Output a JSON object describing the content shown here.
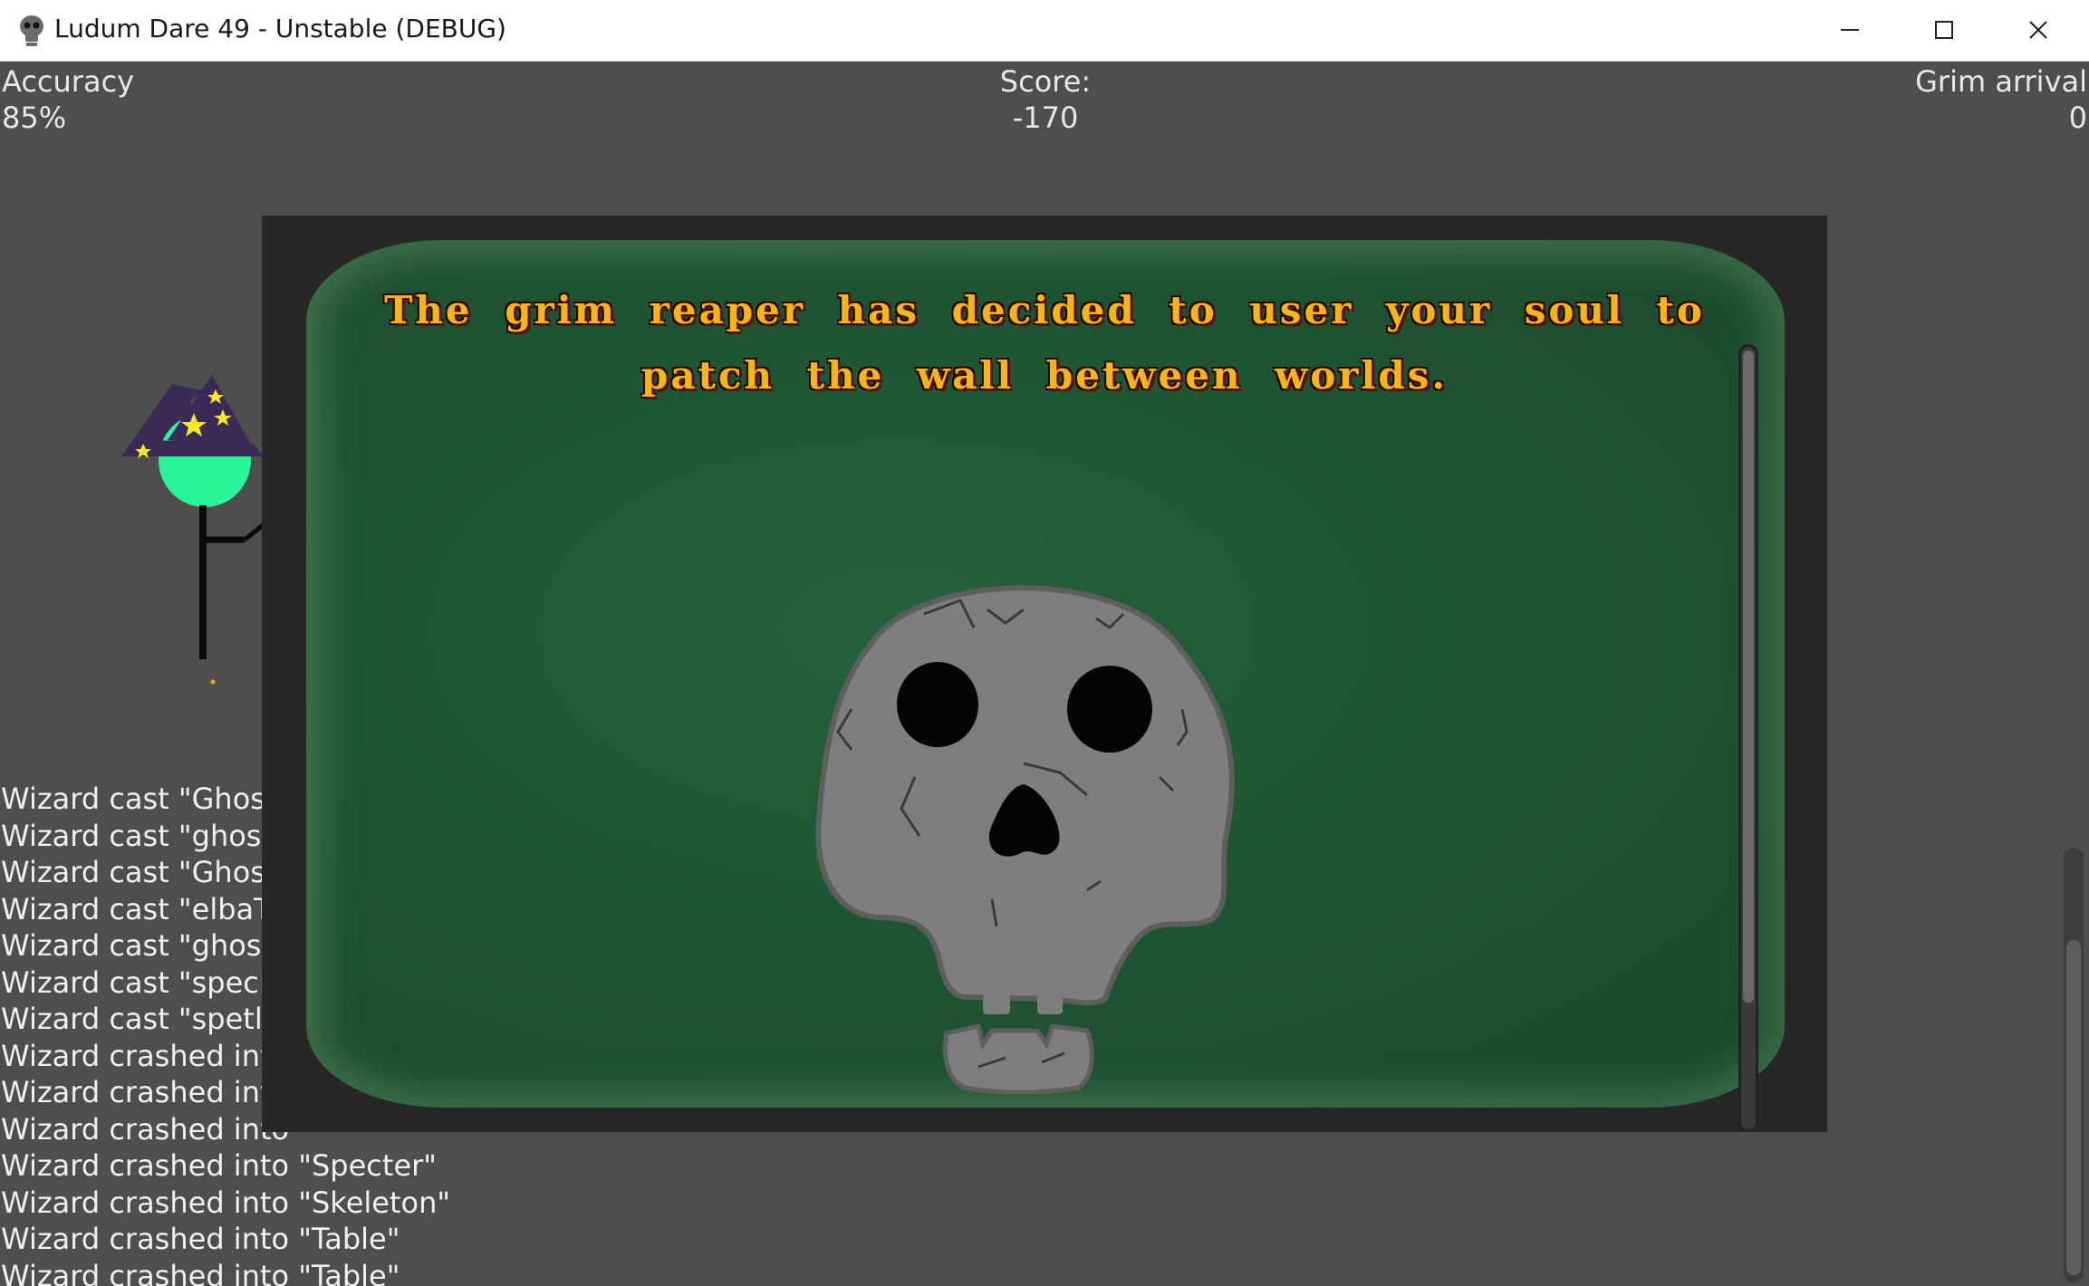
{
  "window": {
    "title": "Ludum Dare 49 - Unstable (DEBUG)",
    "icon": "skull-icon",
    "controls": [
      "minimize-icon",
      "maximize-icon",
      "close-icon"
    ]
  },
  "hud": {
    "accuracy_label": "Accuracy",
    "accuracy_value": "85%",
    "score_label": "Score:",
    "score_value": "-170",
    "grim_label": "Grim arrival",
    "grim_value": "0"
  },
  "log": [
    "Wizard cast \"Ghost\"",
    "Wizard cast \"ghost\"",
    "Wizard cast \"Ghost\"",
    "Wizard cast \"elbaT\"",
    "Wizard cast \"ghost\"",
    "Wizard cast \"special",
    "Wizard cast \"spetlak",
    "Wizard crashed into",
    "Wizard crashed into",
    "Wizard crashed into",
    "Wizard crashed into \"Specter\"",
    "Wizard crashed into \"Skeleton\"",
    "Wizard crashed into \"Table\"",
    "Wizard crashed into \"Table\""
  ],
  "modal": {
    "message": "The grim reaper has decided to user your soul to patch the wall between worlds.",
    "image": "skull-icon"
  },
  "colors": {
    "background": "#4e4e4e",
    "modal_frame": "#272727",
    "panel_green": "#1f5532",
    "message_gold": "#f2b51c",
    "wizard_face": "#2af59a",
    "wizard_hat": "#3a2a55",
    "star_yellow": "#f5e62a"
  }
}
